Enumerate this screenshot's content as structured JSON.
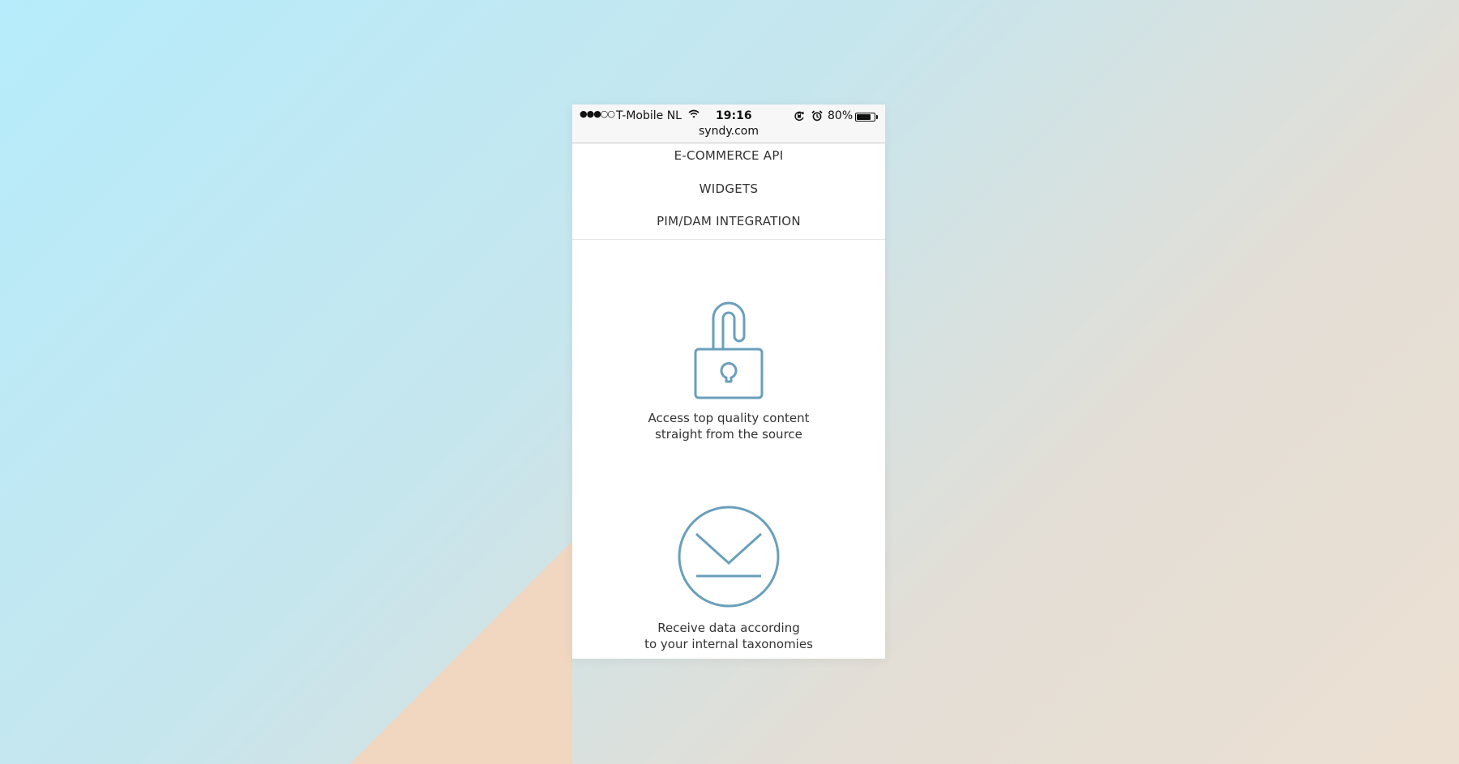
{
  "colors": {
    "icon_stroke": "#6a9fbb",
    "text": "#333333",
    "background_blue": "#b6ecfb",
    "background_peach": "#f1d6c0"
  },
  "statusbar": {
    "signal": "●●●○○",
    "carrier": "T-Mobile NL",
    "wifi_icon": "wifi-icon",
    "time": "19:16",
    "rotation_lock_icon": "rotation-lock-icon",
    "alarm_icon": "alarm-icon",
    "battery_percent": "80%",
    "battery_level": 0.8,
    "url": "syndy.com"
  },
  "nav": {
    "items": [
      {
        "label": "E-COMMERCE API"
      },
      {
        "label": "WIDGETS"
      },
      {
        "label": "PIM/DAM INTEGRATION"
      }
    ]
  },
  "features": [
    {
      "icon": "unlocked-padlock-icon",
      "line1": "Access top quality content",
      "line2": "straight from the source"
    },
    {
      "icon": "download-circle-icon",
      "line1": "Receive data according",
      "line2": "to your internal taxonomies"
    }
  ]
}
